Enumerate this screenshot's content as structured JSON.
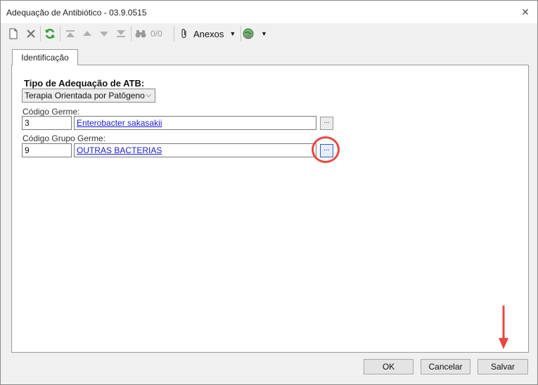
{
  "window": {
    "title": "Adequação de Antibiótico - 03.9.0515",
    "close_symbol": "✕"
  },
  "toolbar": {
    "nav_counter": "0/0",
    "attachments_label": "Anexos",
    "icons": [
      "new-document-icon",
      "delete-icon",
      "refresh-icon",
      "first-record-icon",
      "previous-record-icon",
      "next-record-icon",
      "last-record-icon",
      "binoculars-icon",
      "paperclip-icon",
      "globe-icon"
    ]
  },
  "tabs": [
    {
      "label": "Identificação"
    }
  ],
  "form": {
    "adequacy_type": {
      "label": "Tipo de Adequação de ATB:",
      "selected": "Terapia Orientada por Patôgeno"
    },
    "germ_code": {
      "label": "Código Germe:",
      "code": "3",
      "description": "Enterobacter sakasakii",
      "lookup_label": "..."
    },
    "germ_group_code": {
      "label": "Código Grupo Germe:",
      "code": "9",
      "description": "OUTRAS BACTERIAS",
      "lookup_label": "..."
    }
  },
  "footer": {
    "ok_label": "OK",
    "cancel_label": "Cancelar",
    "save_label": "Salvar"
  },
  "colors": {
    "annotation": "#e8473f",
    "link": "#1a1ad6"
  }
}
